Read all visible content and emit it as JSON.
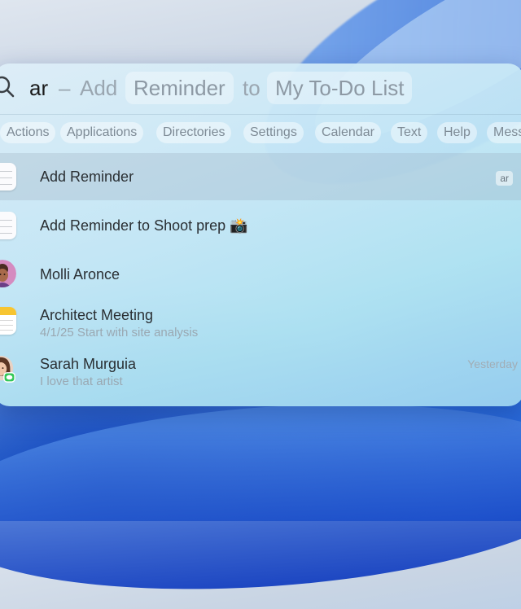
{
  "search": {
    "query": "ar",
    "separator": "–",
    "hint_prefix": "Add",
    "hint_action": "Reminder",
    "hint_joiner": "to",
    "hint_target": "My To-Do List"
  },
  "filters": [
    "Actions",
    "Applications",
    "Directories",
    "Settings",
    "Calendar",
    "Text",
    "Help",
    "Mess"
  ],
  "results": [
    {
      "title": "Add Reminder",
      "subtitle": "",
      "badge": "ar",
      "trailing": "",
      "icon": "reminders-icon",
      "selected": true
    },
    {
      "title": "Add Reminder to Shoot prep 📸",
      "subtitle": "",
      "badge": "",
      "trailing": "",
      "icon": "reminders-icon",
      "selected": false
    },
    {
      "title": "Molli Aronce",
      "subtitle": "",
      "badge": "",
      "trailing": "",
      "icon": "contact-avatar-icon",
      "selected": false
    },
    {
      "title": "Architect Meeting",
      "subtitle": "4/1/25 Start with site analysis",
      "badge": "",
      "trailing": "",
      "icon": "notes-icon",
      "selected": false
    },
    {
      "title": "Sarah Murguia",
      "subtitle": "I love that artist",
      "badge": "",
      "trailing": "Yesterday",
      "icon": "messages-avatar-icon",
      "selected": false
    }
  ],
  "colors": {
    "reminder_dots": [
      "#ff453a",
      "#0a84ff",
      "#ff9f0a"
    ],
    "messages_badge": "#34c759",
    "notes_header": "#f7c531"
  }
}
